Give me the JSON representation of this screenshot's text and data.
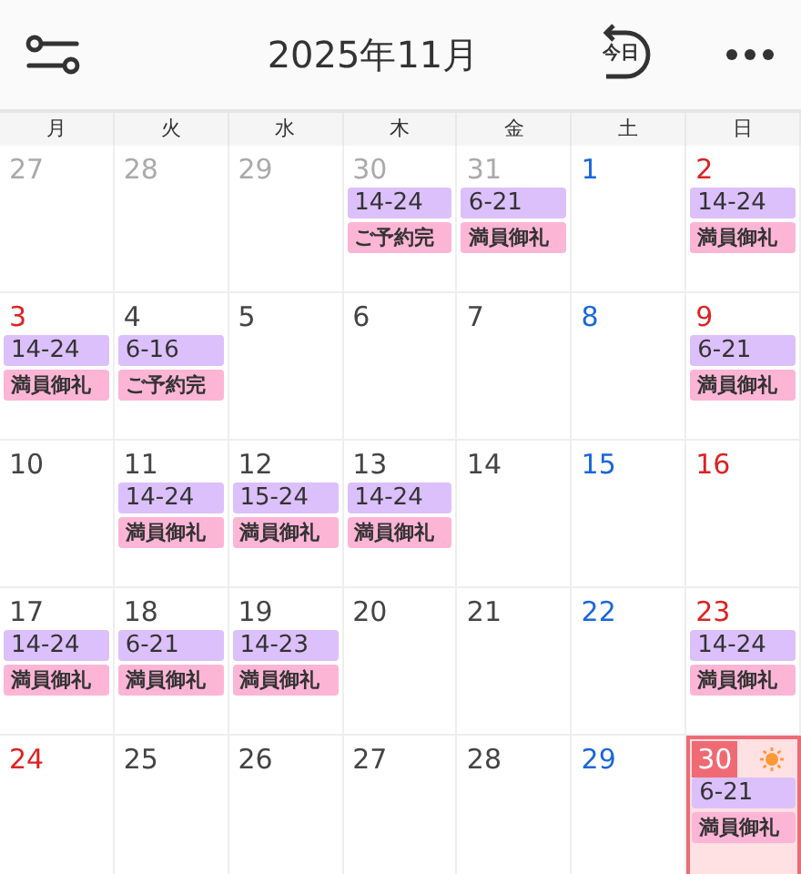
{
  "header": {
    "title": "2025年11月",
    "today_button": {
      "label": "今日"
    }
  },
  "weekdays": [
    "月",
    "火",
    "水",
    "木",
    "金",
    "土",
    "日"
  ],
  "weeks": [
    [
      {
        "day": "27",
        "kind": "other",
        "selected": false
      },
      {
        "day": "28",
        "kind": "other",
        "selected": false
      },
      {
        "day": "29",
        "kind": "other",
        "selected": false
      },
      {
        "day": "30",
        "kind": "other",
        "selected": false,
        "events": [
          {
            "kind": "time",
            "text": "14-24"
          },
          {
            "kind": "note",
            "text": "ご予約完"
          }
        ]
      },
      {
        "day": "31",
        "kind": "other",
        "selected": false,
        "events": [
          {
            "kind": "time",
            "text": "6-21"
          },
          {
            "kind": "note",
            "text": "満員御礼"
          }
        ]
      },
      {
        "day": "1",
        "kind": "saturday",
        "selected": false
      },
      {
        "day": "2",
        "kind": "holiday",
        "selected": false,
        "events": [
          {
            "kind": "time",
            "text": "14-24"
          },
          {
            "kind": "note",
            "text": "満員御礼"
          }
        ]
      }
    ],
    [
      {
        "day": "3",
        "kind": "holiday",
        "selected": false,
        "events": [
          {
            "kind": "time",
            "text": "14-24"
          },
          {
            "kind": "note",
            "text": "満員御礼"
          }
        ]
      },
      {
        "day": "4",
        "kind": "weekday",
        "selected": false,
        "events": [
          {
            "kind": "time",
            "text": "6-16"
          },
          {
            "kind": "note",
            "text": "ご予約完"
          }
        ]
      },
      {
        "day": "5",
        "kind": "weekday",
        "selected": false
      },
      {
        "day": "6",
        "kind": "weekday",
        "selected": false
      },
      {
        "day": "7",
        "kind": "weekday",
        "selected": false
      },
      {
        "day": "8",
        "kind": "saturday",
        "selected": false
      },
      {
        "day": "9",
        "kind": "holiday",
        "selected": false,
        "events": [
          {
            "kind": "time",
            "text": "6-21"
          },
          {
            "kind": "note",
            "text": "満員御礼"
          }
        ]
      }
    ],
    [
      {
        "day": "10",
        "kind": "weekday",
        "selected": false
      },
      {
        "day": "11",
        "kind": "weekday",
        "selected": false,
        "events": [
          {
            "kind": "time",
            "text": "14-24"
          },
          {
            "kind": "note",
            "text": "満員御礼"
          }
        ]
      },
      {
        "day": "12",
        "kind": "weekday",
        "selected": false,
        "events": [
          {
            "kind": "time",
            "text": "15-24"
          },
          {
            "kind": "note",
            "text": "満員御礼"
          }
        ]
      },
      {
        "day": "13",
        "kind": "weekday",
        "selected": false,
        "events": [
          {
            "kind": "time",
            "text": "14-24"
          },
          {
            "kind": "note",
            "text": "満員御礼"
          }
        ]
      },
      {
        "day": "14",
        "kind": "weekday",
        "selected": false
      },
      {
        "day": "15",
        "kind": "saturday",
        "selected": false
      },
      {
        "day": "16",
        "kind": "holiday",
        "selected": false
      }
    ],
    [
      {
        "day": "17",
        "kind": "weekday",
        "selected": false,
        "events": [
          {
            "kind": "time",
            "text": "14-24"
          },
          {
            "kind": "note",
            "text": "満員御礼"
          }
        ]
      },
      {
        "day": "18",
        "kind": "weekday",
        "selected": false,
        "events": [
          {
            "kind": "time",
            "text": "6-21"
          },
          {
            "kind": "note",
            "text": "満員御礼"
          }
        ]
      },
      {
        "day": "19",
        "kind": "weekday",
        "selected": false,
        "events": [
          {
            "kind": "time",
            "text": "14-23"
          },
          {
            "kind": "note",
            "text": "満員御礼"
          }
        ]
      },
      {
        "day": "20",
        "kind": "weekday",
        "selected": false
      },
      {
        "day": "21",
        "kind": "weekday",
        "selected": false
      },
      {
        "day": "22",
        "kind": "saturday",
        "selected": false
      },
      {
        "day": "23",
        "kind": "holiday",
        "selected": false,
        "events": [
          {
            "kind": "time",
            "text": "14-24"
          },
          {
            "kind": "note",
            "text": "満員御礼"
          }
        ]
      }
    ],
    [
      {
        "day": "24",
        "kind": "holiday",
        "selected": false
      },
      {
        "day": "25",
        "kind": "weekday",
        "selected": false
      },
      {
        "day": "26",
        "kind": "weekday",
        "selected": false
      },
      {
        "day": "27",
        "kind": "weekday",
        "selected": false
      },
      {
        "day": "28",
        "kind": "weekday",
        "selected": false
      },
      {
        "day": "29",
        "kind": "saturday",
        "selected": false
      },
      {
        "day": "30",
        "selected": true,
        "events": [
          {
            "kind": "time",
            "text": "6-21"
          },
          {
            "kind": "note",
            "text": "満員御礼"
          }
        ]
      }
    ]
  ]
}
